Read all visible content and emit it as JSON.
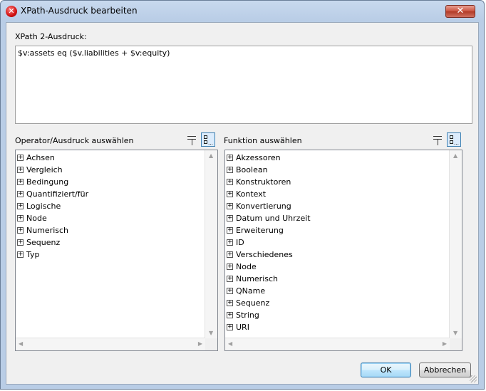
{
  "window": {
    "title": "XPath-Ausdruck bearbeiten",
    "close_glyph": "✕"
  },
  "expression": {
    "label": "XPath 2-Ausdruck:",
    "value": "$v:assets eq ($v.liabilities + $v:equity)"
  },
  "operators": {
    "label": "Operator/Ausdruck auswählen",
    "items": [
      "Achsen",
      "Vergleich",
      "Bedingung",
      "Quantifiziert/für",
      "Logische",
      "Node",
      "Numerisch",
      "Sequenz",
      "Typ"
    ]
  },
  "functions": {
    "label": "Funktion auswählen",
    "items": [
      "Akzessoren",
      "Boolean",
      "Konstruktoren",
      "Kontext",
      "Konvertierung",
      "Datum und Uhrzeit",
      "Erweiterung",
      "ID",
      "Verschiedenes",
      "Node",
      "Numerisch",
      "QName",
      "Sequenz",
      "String",
      "URI"
    ]
  },
  "buttons": {
    "ok": "OK",
    "cancel": "Abbrechen"
  },
  "icons": {
    "app": "xpath-app-icon",
    "close": "close-icon",
    "sort": "sort-list-icon",
    "tree": "tree-view-icon",
    "expand": "plus-box-icon"
  },
  "colors": {
    "title_gradient": "#b9cde6",
    "close_button": "#c9503c",
    "dialog_bg": "#f0f0f0"
  }
}
